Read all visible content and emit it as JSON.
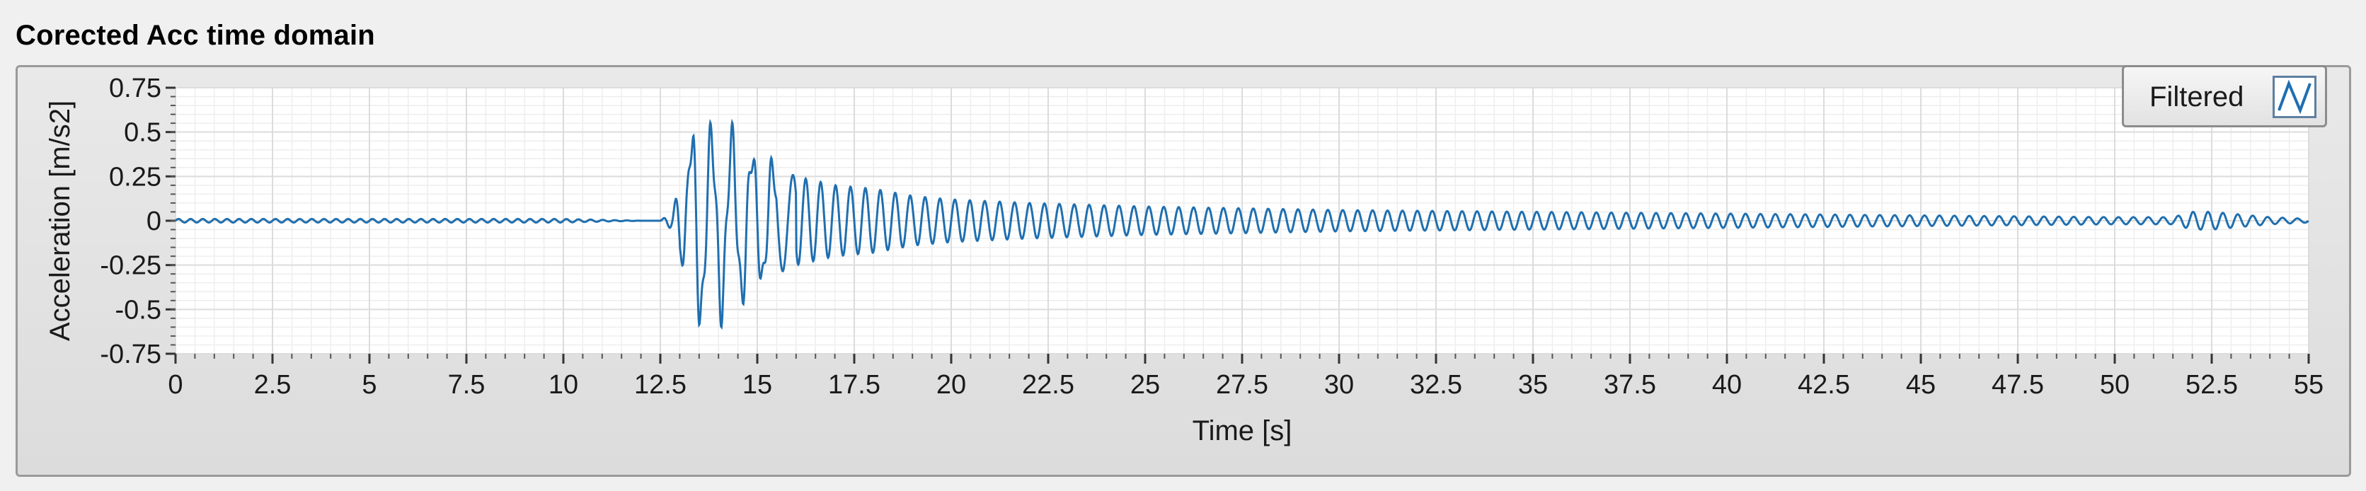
{
  "panel": {
    "title": "Corected Acc time domain"
  },
  "legend": {
    "label": "Filtered",
    "icon": "line-plot-legend-icon"
  },
  "colors": {
    "trace": "#1f6fb0",
    "grid": "#dcdcdc",
    "plot_bg": "#ffffff"
  },
  "chart_data": {
    "type": "line",
    "title": "Corected Acc time domain",
    "xlabel": "Time [s]",
    "ylabel": "Acceleration [m/s2]",
    "xlim": [
      0,
      55
    ],
    "ylim": [
      -0.75,
      0.75
    ],
    "xticks": [
      "0",
      "2.5",
      "5",
      "7.5",
      "10",
      "12.5",
      "15",
      "17.5",
      "20",
      "22.5",
      "25",
      "27.5",
      "30",
      "32.5",
      "35",
      "37.5",
      "40",
      "42.5",
      "45",
      "47.5",
      "50",
      "52.5",
      "55"
    ],
    "yticks": [
      "0.75",
      "0.5",
      "0.25",
      "0",
      "-0.25",
      "-0.5",
      "-0.75"
    ],
    "grid": true,
    "legend_position": "top-right",
    "series": [
      {
        "name": "Filtered",
        "x": [
          0,
          2,
          4,
          6,
          8,
          10,
          12,
          12.5,
          12.8,
          13.0,
          13.2,
          13.35,
          13.5,
          13.7,
          13.9,
          14.1,
          14.3,
          14.5,
          14.7,
          15.0,
          15.5,
          16,
          17,
          18,
          19,
          20,
          22,
          25,
          27.5,
          30,
          35,
          40,
          45,
          50,
          51.5,
          52,
          52.5,
          53,
          54,
          55
        ],
        "y": [
          0.01,
          -0.01,
          0.01,
          -0.01,
          0.01,
          -0.01,
          0.0,
          0.0,
          0.05,
          -0.2,
          0.3,
          0.55,
          -0.58,
          0.45,
          -0.5,
          0.48,
          -0.45,
          0.45,
          -0.4,
          0.35,
          -0.3,
          0.25,
          -0.2,
          0.18,
          -0.14,
          0.12,
          -0.1,
          0.08,
          -0.07,
          0.06,
          -0.05,
          0.04,
          -0.03,
          0.02,
          -0.02,
          0.05,
          -0.05,
          0.04,
          -0.02,
          0.01
        ]
      }
    ]
  }
}
